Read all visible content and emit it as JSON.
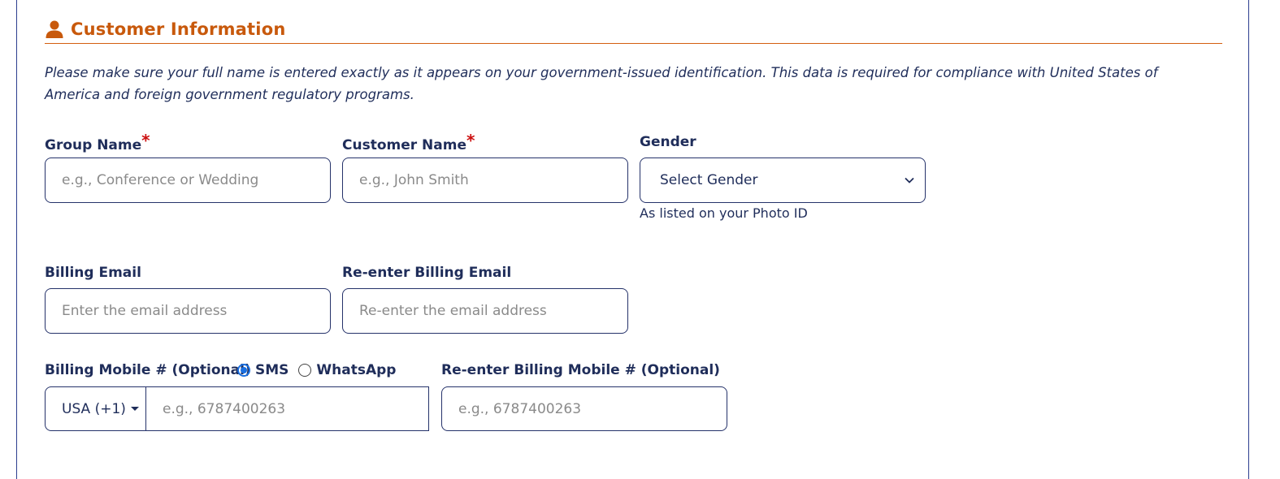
{
  "section": {
    "title": "Customer Information",
    "icon": "user-icon",
    "accent_color": "#c8590c",
    "notice": "Please make sure your full name is entered exactly as it appears on your government-issued identification. This data is required for compliance with United States of America and foreign government regulatory programs."
  },
  "fields": {
    "group_name": {
      "label": "Group Name",
      "required_mark": "*",
      "placeholder": "e.g., Conference or Wedding",
      "value": ""
    },
    "customer_name": {
      "label": "Customer Name",
      "required_mark": "*",
      "placeholder": "e.g., John Smith",
      "value": ""
    },
    "gender": {
      "label": "Gender",
      "selected": "Select Gender",
      "helper": "As listed on your Photo ID"
    },
    "billing_email": {
      "label": "Billing Email",
      "placeholder": "Enter the email address",
      "value": ""
    },
    "reenter_email": {
      "label": "Re-enter Billing Email",
      "placeholder": "Re-enter the email address",
      "value": ""
    },
    "billing_mobile": {
      "label": "Billing Mobile # (Optional)",
      "options": [
        {
          "label": "SMS",
          "checked": true
        },
        {
          "label": "WhatsApp",
          "checked": false
        }
      ],
      "country_code": "USA (+1)",
      "placeholder": "e.g., 6787400263",
      "value": ""
    },
    "reenter_mobile": {
      "label": "Re-enter Billing Mobile # (Optional)",
      "placeholder": "e.g., 6787400263",
      "value": ""
    }
  }
}
